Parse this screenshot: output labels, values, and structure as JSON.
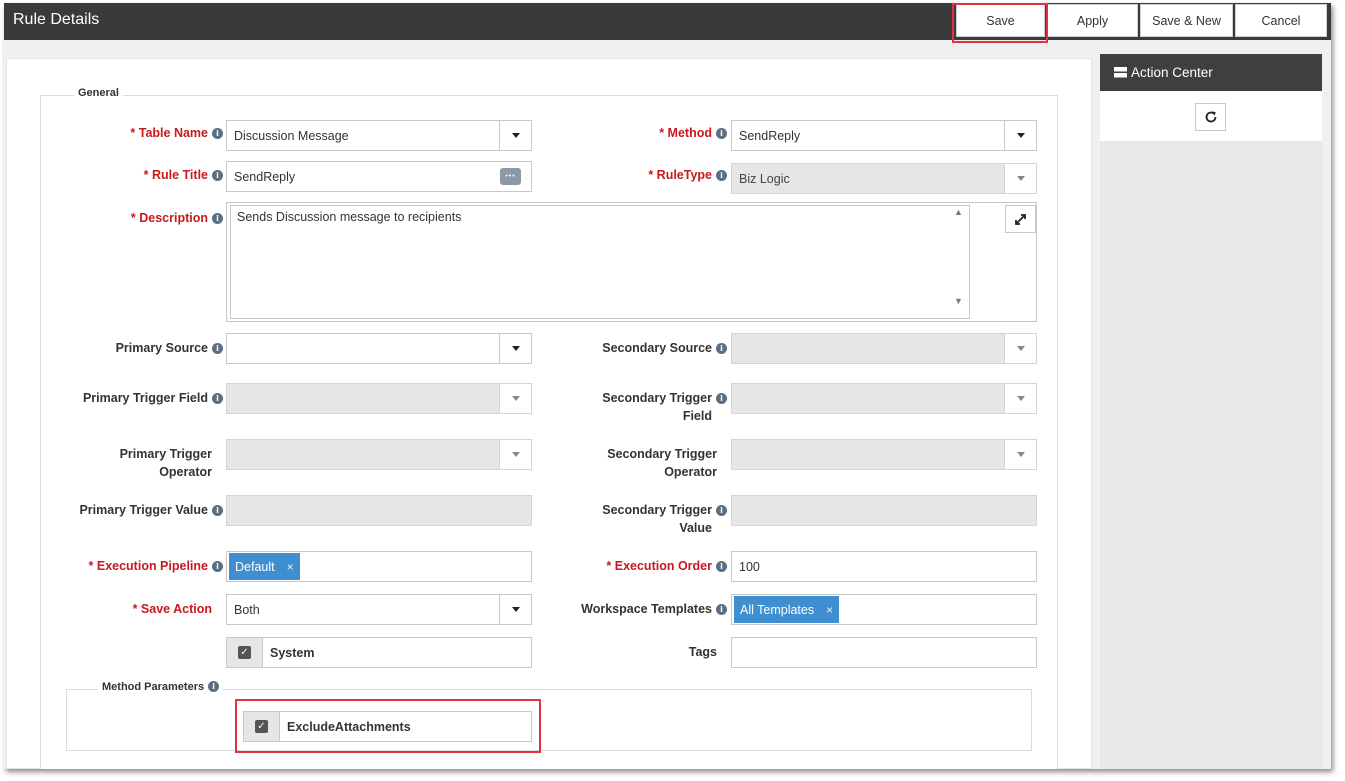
{
  "window": {
    "title": "Rule Details"
  },
  "toolbar": {
    "save": "Save",
    "apply": "Apply",
    "save_new": "Save & New",
    "cancel": "Cancel"
  },
  "sidebar": {
    "title": "Action Center"
  },
  "general": {
    "legend": "General",
    "table_name": {
      "label": "* Table Name",
      "value": "Discussion Message"
    },
    "method": {
      "label": "* Method",
      "value": "SendReply"
    },
    "rule_title": {
      "label": "* Rule Title",
      "value": "SendReply"
    },
    "rule_type": {
      "label": "* RuleType",
      "value": "Biz Logic"
    },
    "description": {
      "label": "* Description",
      "value": "Sends Discussion message to recipients"
    },
    "primary_source": {
      "label": "Primary Source",
      "value": ""
    },
    "secondary_source": {
      "label": "Secondary Source",
      "value": ""
    },
    "primary_trigger_field": {
      "label": "Primary Trigger Field"
    },
    "secondary_trigger_field": {
      "label_1": "Secondary Trigger",
      "label_2": "Field"
    },
    "primary_trigger_operator": {
      "label_1": "Primary Trigger",
      "label_2": "Operator"
    },
    "secondary_trigger_operator": {
      "label_1": "Secondary Trigger",
      "label_2": "Operator"
    },
    "primary_trigger_value": {
      "label": "Primary Trigger Value"
    },
    "secondary_trigger_value": {
      "label_1": "Secondary Trigger",
      "label_2": "Value"
    },
    "execution_pipeline": {
      "label": "* Execution Pipeline",
      "tag": "Default"
    },
    "execution_order": {
      "label": "* Execution Order",
      "value": "100"
    },
    "save_action": {
      "label": "* Save Action",
      "value": "Both"
    },
    "workspace_templates": {
      "label": "Workspace Templates",
      "tag": "All Templates"
    },
    "system": {
      "label": "System",
      "checked": true
    },
    "tags": {
      "label": "Tags",
      "value": ""
    }
  },
  "method_parameters": {
    "legend": "Method Parameters",
    "exclude_attachments": {
      "label": "ExcludeAttachments",
      "checked": true
    }
  },
  "icons": {
    "info": "i",
    "check": "✓",
    "tag_remove": "×",
    "ellipsis": "•••",
    "scroll_up": "▲",
    "scroll_down": "▼"
  },
  "colors": {
    "titlebar": "#3a3a3a",
    "required": "#c9181e",
    "tag": "#3e8ed0",
    "highlight": "#e0343a"
  }
}
